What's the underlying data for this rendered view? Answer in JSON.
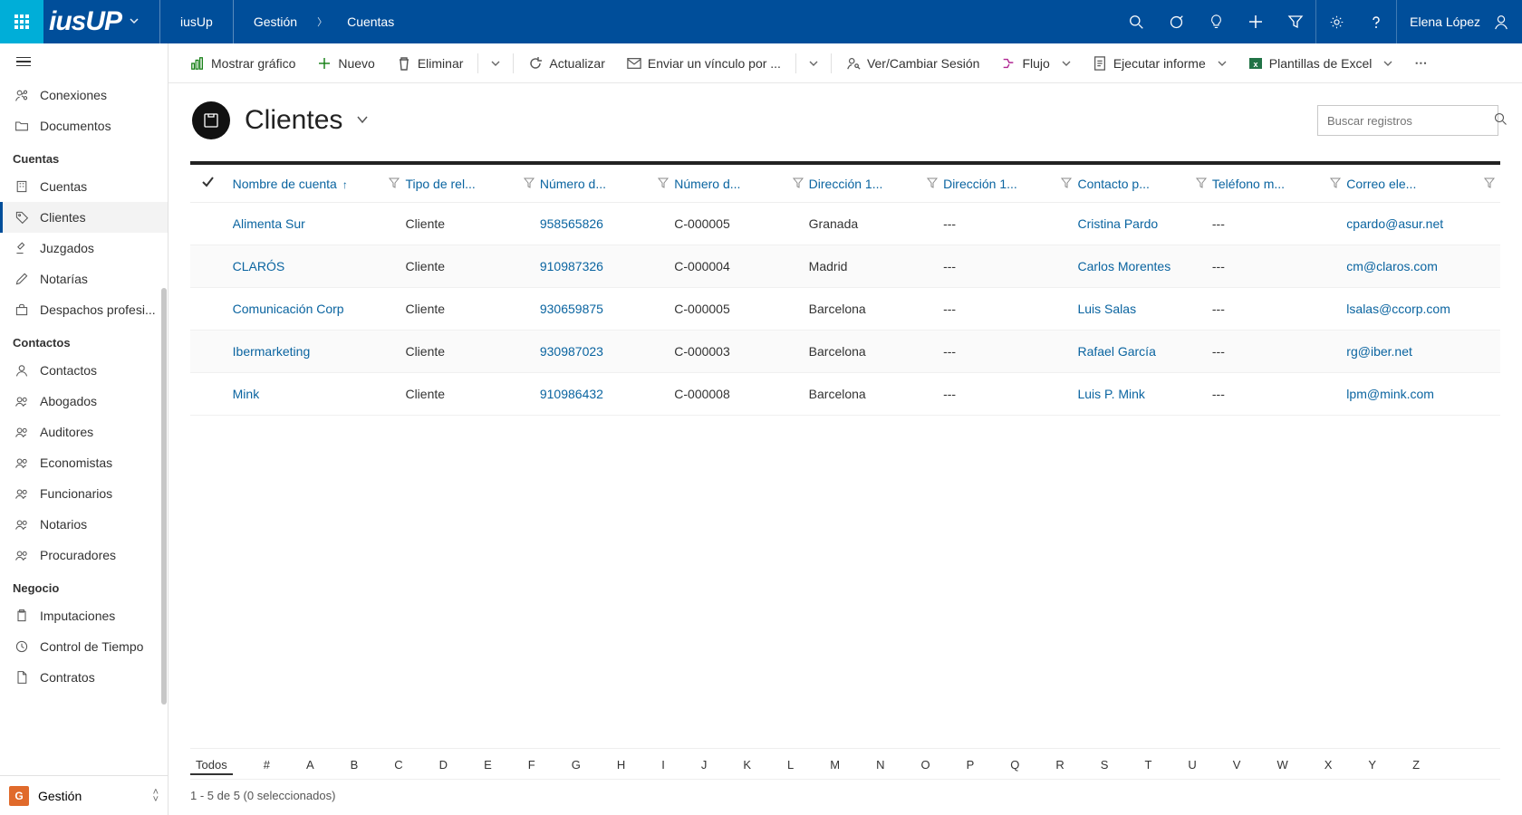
{
  "colors": {
    "primary": "#004e9a",
    "accent": "#00aed8",
    "link": "#0a64a0"
  },
  "header": {
    "appName": "iusUp",
    "breadcrumb": [
      "Gestión",
      "Cuentas"
    ],
    "userName": "Elena López"
  },
  "sidebar": {
    "top": [
      {
        "label": "Conexiones",
        "icon": "user-share"
      },
      {
        "label": "Documentos",
        "icon": "folder"
      }
    ],
    "groups": [
      {
        "title": "Cuentas",
        "items": [
          {
            "label": "Cuentas",
            "icon": "building"
          },
          {
            "label": "Clientes",
            "icon": "tag",
            "active": true
          },
          {
            "label": "Juzgados",
            "icon": "gavel"
          },
          {
            "label": "Notarías",
            "icon": "pen"
          },
          {
            "label": "Despachos profesi...",
            "icon": "briefcase"
          }
        ]
      },
      {
        "title": "Contactos",
        "items": [
          {
            "label": "Contactos",
            "icon": "person"
          },
          {
            "label": "Abogados",
            "icon": "people"
          },
          {
            "label": "Auditores",
            "icon": "people"
          },
          {
            "label": "Economistas",
            "icon": "people"
          },
          {
            "label": "Funcionarios",
            "icon": "people"
          },
          {
            "label": "Notarios",
            "icon": "people"
          },
          {
            "label": "Procuradores",
            "icon": "people"
          }
        ]
      },
      {
        "title": "Negocio",
        "items": [
          {
            "label": "Imputaciones",
            "icon": "clipboard"
          },
          {
            "label": "Control de Tiempo",
            "icon": "clock"
          },
          {
            "label": "Contratos",
            "icon": "document"
          }
        ]
      }
    ],
    "footer": {
      "tile": "G",
      "label": "Gestión"
    }
  },
  "commandBar": {
    "items": [
      {
        "label": "Mostrar gráfico",
        "icon": "chart",
        "color": "#107c10"
      },
      {
        "label": "Nuevo",
        "icon": "plus",
        "color": "#107c10"
      },
      {
        "label": "Eliminar",
        "icon": "trash",
        "split": true
      },
      {
        "label": "Actualizar",
        "icon": "refresh"
      },
      {
        "label": "Enviar un vínculo por ...",
        "icon": "mail",
        "split": true
      },
      {
        "label": "Ver/Cambiar Sesión",
        "icon": "person-key"
      },
      {
        "label": "Flujo",
        "icon": "flow",
        "chevron": true
      },
      {
        "label": "Ejecutar informe",
        "icon": "report",
        "chevron": true
      },
      {
        "label": "Plantillas de Excel",
        "icon": "excel",
        "chevron": true
      }
    ]
  },
  "view": {
    "title": "Clientes",
    "searchPlaceholder": "Buscar registros"
  },
  "grid": {
    "columns": [
      "Nombre de cuenta",
      "Tipo de rel...",
      "Número d...",
      "Número d...",
      "Dirección 1...",
      "Dirección 1...",
      "Contacto p...",
      "Teléfono m...",
      "Correo ele..."
    ],
    "rows": [
      {
        "name": "Alimenta Sur",
        "type": "Cliente",
        "num1": "958565826",
        "num2": "C-000005",
        "addr1": "Granada",
        "addr2": "---",
        "contact": "Cristina Pardo",
        "phone": "---",
        "email": "cpardo@asur.net"
      },
      {
        "name": "CLARÓS",
        "type": "Cliente",
        "num1": "910987326",
        "num2": "C-000004",
        "addr1": "Madrid",
        "addr2": "---",
        "contact": "Carlos Morentes",
        "phone": "---",
        "email": "cm@claros.com"
      },
      {
        "name": "Comunicación Corp",
        "type": "Cliente",
        "num1": "930659875",
        "num2": "C-000005",
        "addr1": "Barcelona",
        "addr2": "---",
        "contact": "Luis Salas",
        "phone": "---",
        "email": "lsalas@ccorp.com"
      },
      {
        "name": "Ibermarketing",
        "type": "Cliente",
        "num1": "930987023",
        "num2": "C-000003",
        "addr1": "Barcelona",
        "addr2": "---",
        "contact": "Rafael García",
        "phone": "---",
        "email": "rg@iber.net"
      },
      {
        "name": "Mink",
        "type": "Cliente",
        "num1": "910986432",
        "num2": "C-000008",
        "addr1": "Barcelona",
        "addr2": "---",
        "contact": "Luis P. Mink",
        "phone": "---",
        "email": "lpm@mink.com"
      }
    ]
  },
  "alphaBar": {
    "all": "Todos",
    "letters": [
      "#",
      "A",
      "B",
      "C",
      "D",
      "E",
      "F",
      "G",
      "H",
      "I",
      "J",
      "K",
      "L",
      "M",
      "N",
      "O",
      "P",
      "Q",
      "R",
      "S",
      "T",
      "U",
      "V",
      "W",
      "X",
      "Y",
      "Z"
    ]
  },
  "status": "1 - 5 de 5 (0 seleccionados)"
}
